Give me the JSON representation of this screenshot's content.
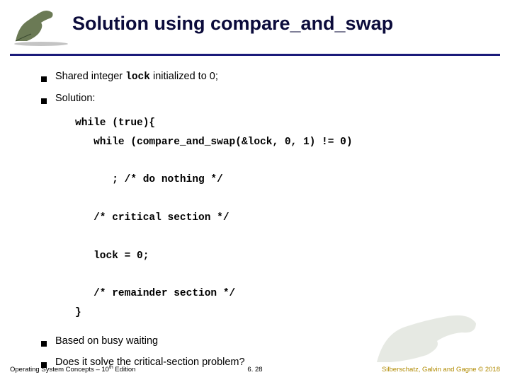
{
  "header": {
    "title": "Solution using compare_and_swap"
  },
  "bullets": {
    "b1_pre": "Shared integer ",
    "b1_code": "lock",
    "b1_post": "  initialized to 0;",
    "b2": "Solution:",
    "b3": "Based on busy waiting",
    "b4": "Does it solve the critical-section problem?"
  },
  "code": "while (true){\n   while (compare_and_swap(&lock, 0, 1) != 0)\n\n      ; /* do nothing */\n\n   /* critical section */\n\n   lock = 0;\n\n   /* remainder section */\n}",
  "footer": {
    "left_a": "Operating System Concepts – 10",
    "left_sup": "th",
    "left_b": " Edition",
    "mid": "6. 28",
    "right_a": "Silberschatz, Galvin and Gagne ",
    "right_c": "©",
    "right_b": " 2018"
  }
}
